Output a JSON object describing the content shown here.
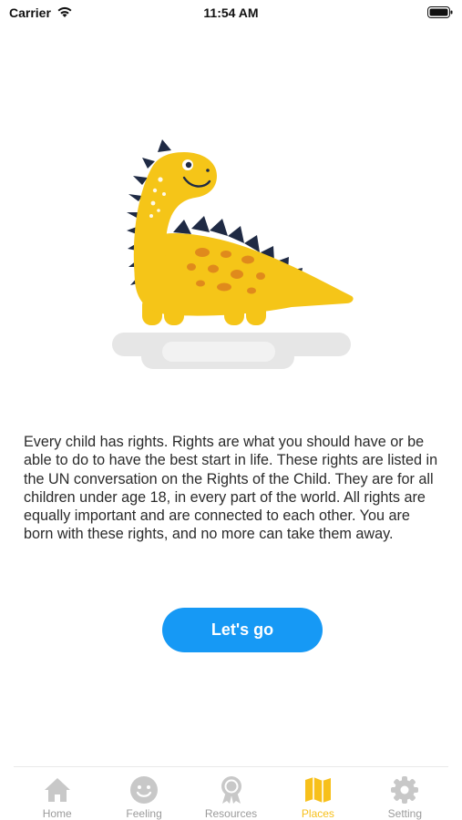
{
  "status_bar": {
    "carrier": "Carrier",
    "time": "11:54 AM"
  },
  "illustration": {
    "icon": "dinosaur-illustration",
    "colors": {
      "body": "#f5c518",
      "spikes": "#1f2a44",
      "spots": "#e08a1c",
      "shadow": "#e5e5e5"
    }
  },
  "intro": {
    "text": "Every child has rights. Rights are what you should have or be able to do to have the best start in life. These rights are listed in the UN conversation on the Rights of the Child. They are for all children under age 18, in every part of the world. All rights are equally important and are connected to each other. You are born with these rights, and no more can take them away."
  },
  "cta": {
    "label": "Let's go",
    "color": "#1699f5"
  },
  "tab_bar": {
    "active_color": "#f7c01b",
    "inactive_color": "#9b9b9b",
    "tabs": [
      {
        "label": "Home",
        "icon": "home-icon",
        "active": false
      },
      {
        "label": "Feeling",
        "icon": "smiley-icon",
        "active": false
      },
      {
        "label": "Resources",
        "icon": "award-icon",
        "active": false
      },
      {
        "label": "Places",
        "icon": "map-icon",
        "active": true
      },
      {
        "label": "Setting",
        "icon": "gear-icon",
        "active": false
      }
    ]
  }
}
